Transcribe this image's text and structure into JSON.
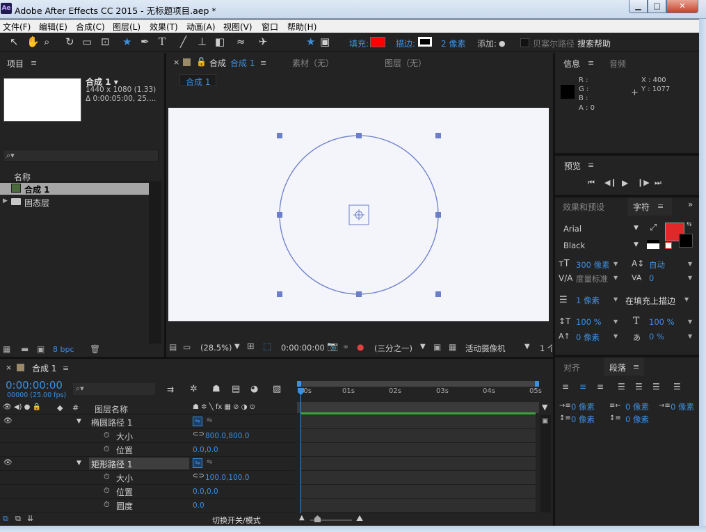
{
  "window": {
    "title": "Adobe After Effects CC 2015 - 无标题项目.aep *",
    "app_badge": "Ae",
    "minimize": "▁",
    "maximize": "□",
    "close": "✕"
  },
  "menu": [
    "文件(F)",
    "编辑(E)",
    "合成(C)",
    "图层(L)",
    "效果(T)",
    "动画(A)",
    "视图(V)",
    "窗口",
    "帮助(H)"
  ],
  "toolbar": {
    "fill_label": "填充:",
    "stroke_label": "描边:",
    "stroke_width": "2 像素",
    "add_label": "添加:",
    "search_help": "搜索帮助",
    "overlay_text": "贝塞尔路径",
    "fill_color": "#ff0000"
  },
  "project": {
    "tab": "项目",
    "comp_name": "合成 1 ▾",
    "comp_dims": "1440 x 1080 (1.33)",
    "comp_duration": "Δ 0:00:05:00, 25....",
    "col_name": "名称",
    "items": [
      "合成 1",
      "固态层"
    ],
    "bpc": "8 bpc"
  },
  "viewer": {
    "tab_prefix": "合成",
    "tab_name": "合成 1",
    "tab_footage": "素材（无）",
    "tab_layer": "图层（无）",
    "breadcrumb": "合成 1",
    "zoom": "(28.5%)",
    "timecode": "0:00:00:00",
    "resolution": "(三分之一)",
    "camera": "活动摄像机",
    "views": "1 个"
  },
  "info": {
    "tab": "信息",
    "audio_tab": "音频",
    "r": "R :",
    "g": "G :",
    "b": "B :",
    "a": "A : 0",
    "x": "X : 400",
    "y": "Y : 1077"
  },
  "preview": {
    "tab": "预览"
  },
  "character": {
    "effects_tab": "效果和预设",
    "tab": "字符",
    "font": "Arial",
    "style": "Black",
    "size": "300 像素",
    "leading": "自动",
    "kerning": "度量标准",
    "tracking": "0",
    "stroke_w": "1 像素",
    "stroke_mode": "在填充上描边",
    "vscale": "100 %",
    "hscale": "100 %",
    "baseline": "0 像素",
    "tsume": "0 %",
    "swatch_color": "#e02828"
  },
  "paragraph": {
    "align_tab": "对齐",
    "tab": "段落",
    "indent_left": "0 像素",
    "indent_right": "0 像素",
    "indent_first": "0 像素",
    "space_before": "0 像素",
    "space_after": "0 像素"
  },
  "timeline": {
    "tab": "合成 1",
    "timecode": "0:00:00:00",
    "fps": "00000 (25.00 fps)",
    "col_num": "#",
    "col_layer": "图层名称",
    "ruler": [
      "00s",
      "01s",
      "02s",
      "03s",
      "04s",
      "05s"
    ],
    "rows": [
      {
        "name": "椭圆路径 1",
        "kind": "layer"
      },
      {
        "name": "大小",
        "value": "800.0,800.0"
      },
      {
        "name": "位置",
        "value": "0.0,0.0"
      },
      {
        "name": "矩形路径 1",
        "kind": "layer"
      },
      {
        "name": "大小",
        "value": "100.0,100.0"
      },
      {
        "name": "位置",
        "value": "0.0,0.0"
      },
      {
        "name": "圆度",
        "value": "0.0"
      }
    ],
    "toggle_switches": "切换开关/模式"
  }
}
